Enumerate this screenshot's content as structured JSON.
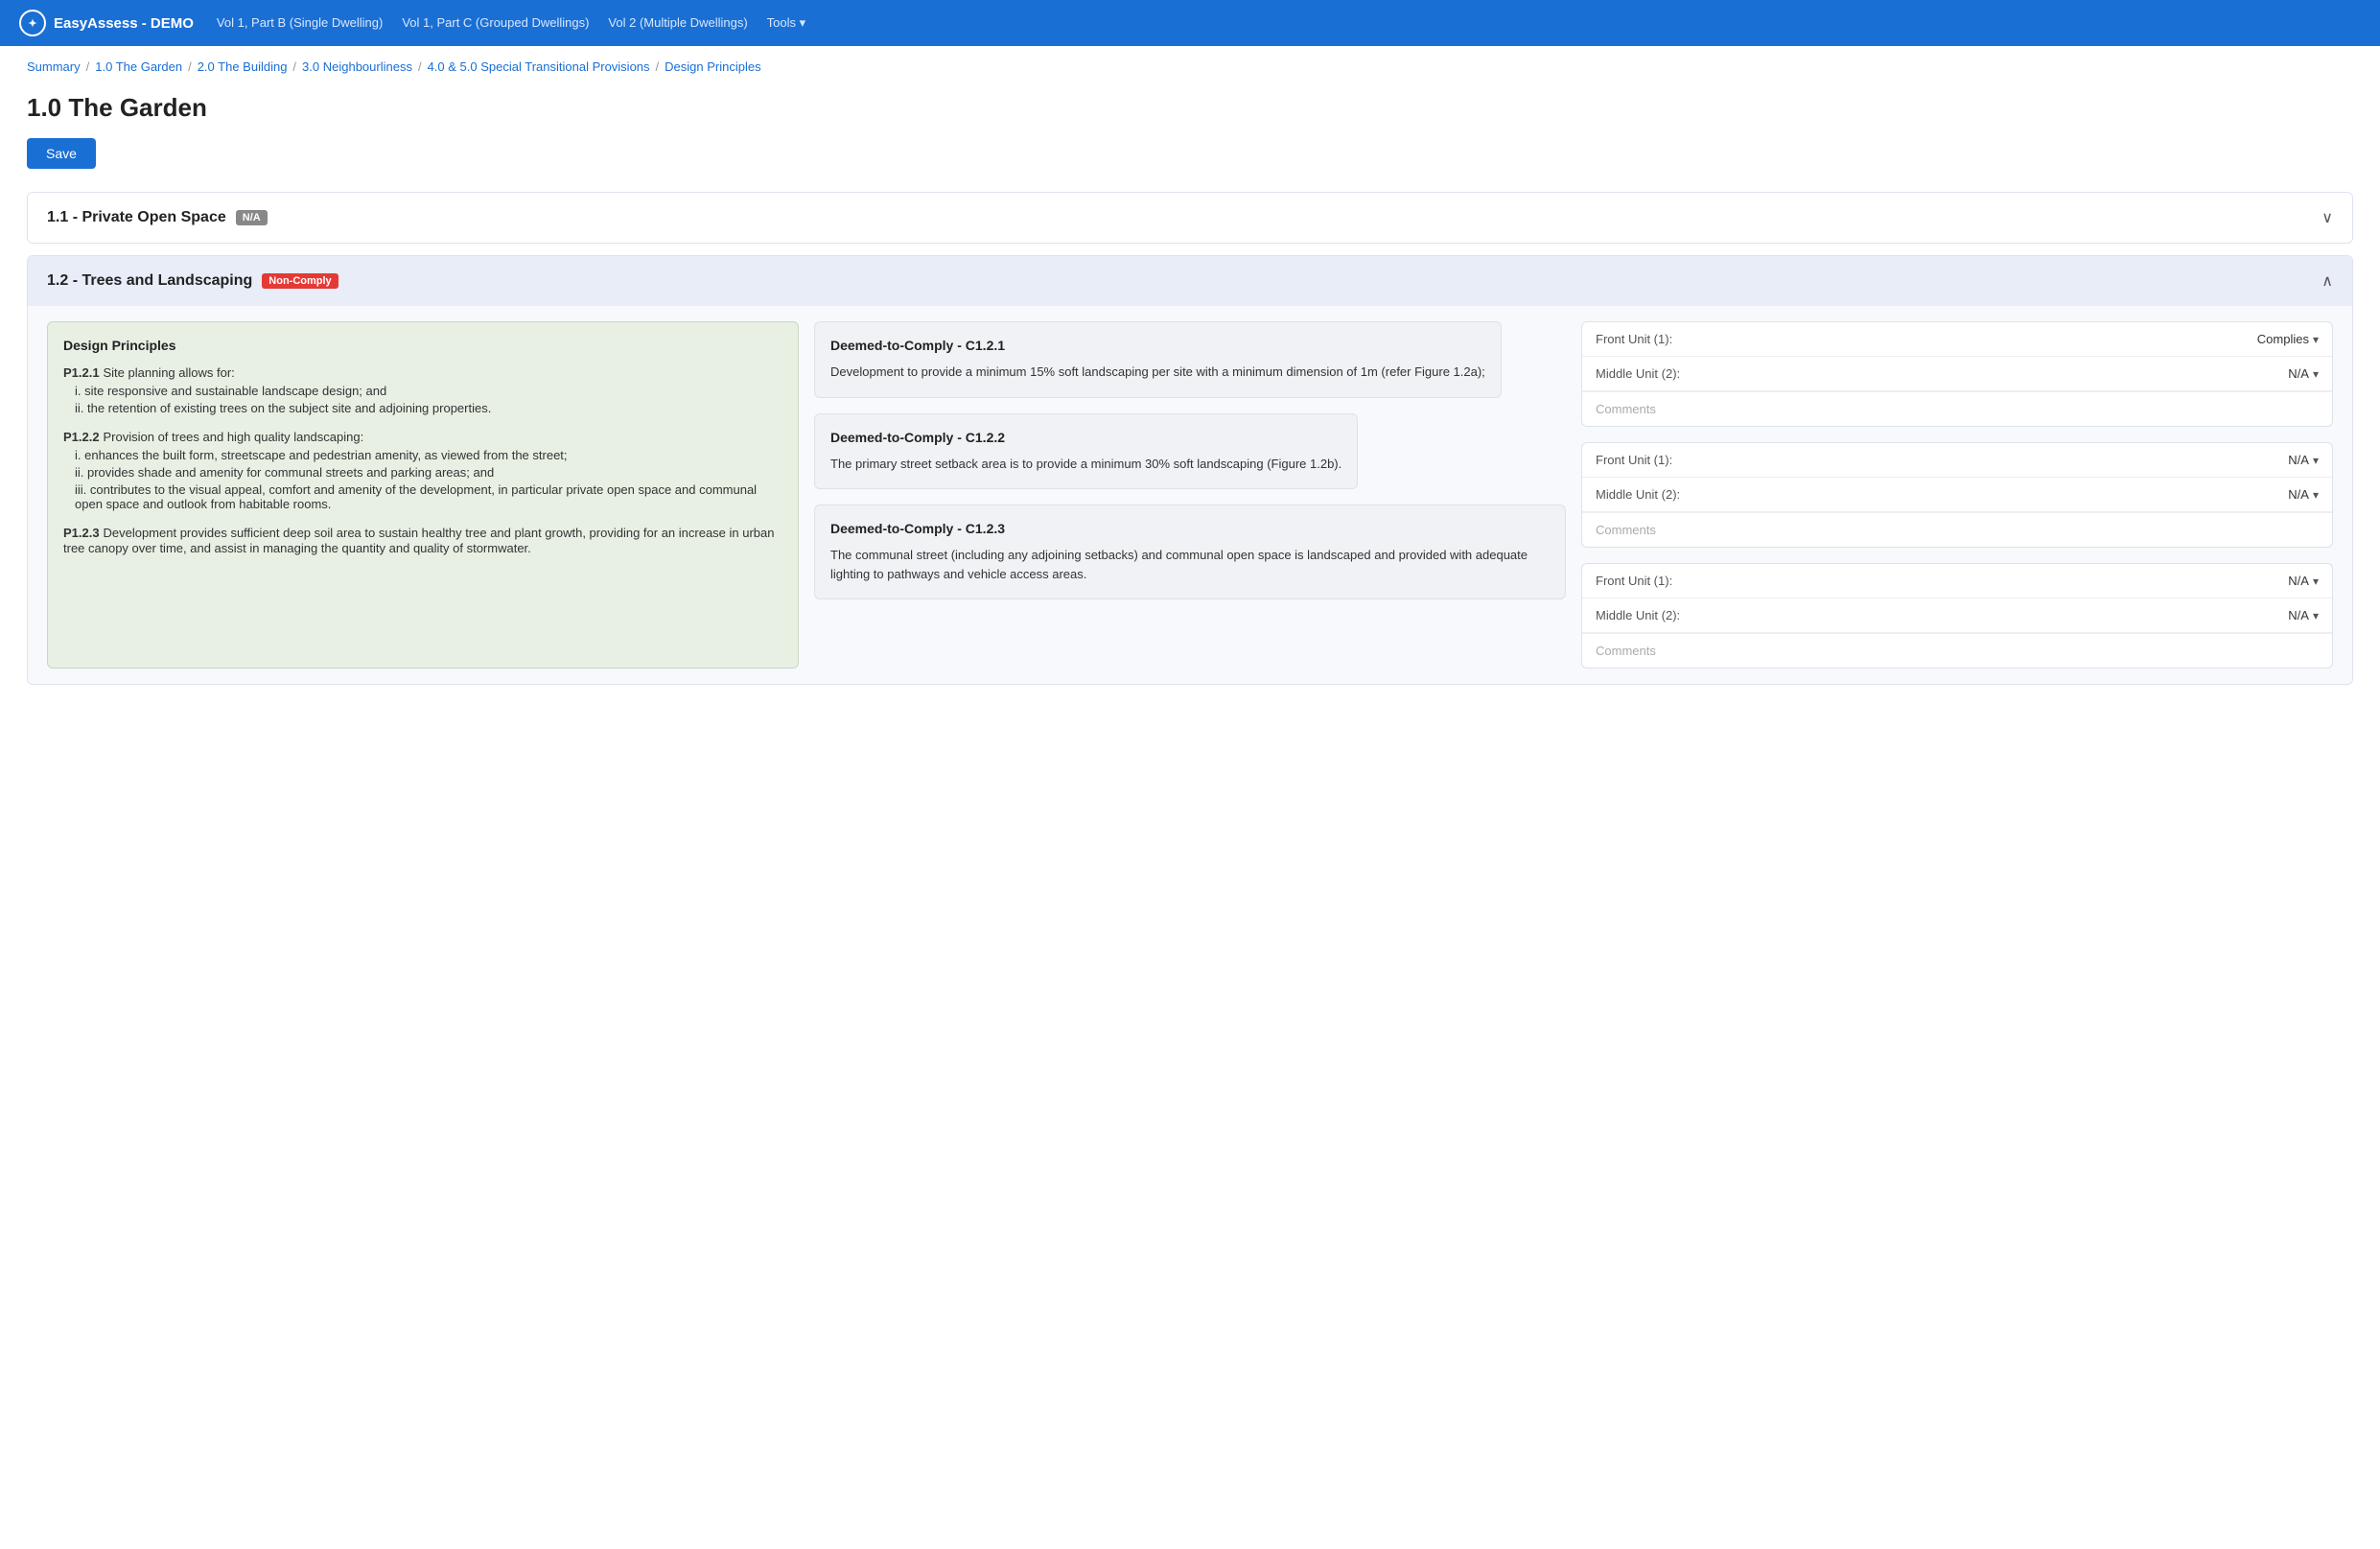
{
  "nav": {
    "brand": "EasyAssess - DEMO",
    "brand_icon": "EA",
    "links": [
      {
        "label": "Vol 1, Part B (Single Dwelling)"
      },
      {
        "label": "Vol 1, Part C (Grouped Dwellings)"
      },
      {
        "label": "Vol 2 (Multiple Dwellings)"
      },
      {
        "label": "Tools ▾"
      }
    ]
  },
  "breadcrumb": {
    "items": [
      {
        "label": "Summary"
      },
      {
        "label": "1.0 The Garden"
      },
      {
        "label": "2.0 The Building"
      },
      {
        "label": "3.0 Neighbourliness"
      },
      {
        "label": "4.0 & 5.0 Special Transitional Provisions"
      },
      {
        "label": "Design Principles"
      }
    ]
  },
  "page": {
    "title": "1.0 The Garden",
    "save_button": "Save"
  },
  "sections": [
    {
      "id": "s1",
      "title": "1.1 - Private Open Space",
      "badge_text": "N/A",
      "badge_type": "na",
      "expanded": false
    },
    {
      "id": "s2",
      "title": "1.2 - Trees and Landscaping",
      "badge_text": "Non-Comply",
      "badge_type": "noncomply",
      "expanded": true,
      "design_principles": {
        "title": "Design Principles",
        "items": [
          {
            "label": "P1.2.1",
            "text": " Site planning allows for:",
            "list": [
              "i.  site responsive and sustainable landscape design; and",
              "ii. the retention of existing trees on the subject site and adjoining properties."
            ]
          },
          {
            "label": "P1.2.2",
            "text": " Provision of trees and high quality landscaping:",
            "list": [
              "i.  enhances the built form, streetscape and pedestrian amenity, as viewed from the street;",
              "ii. provides shade and amenity for communal streets and parking areas; and",
              "iii. contributes to the visual appeal, comfort and amenity of the development, in particular private open space and communal open space and outlook from habitable rooms."
            ]
          },
          {
            "label": "P1.2.3",
            "text": " Development provides sufficient deep soil area to sustain healthy tree and plant growth, providing for an increase in urban tree canopy over time, and assist in managing the quantity and quality of stormwater.",
            "list": []
          }
        ]
      },
      "dtc_cards": [
        {
          "id": "c1",
          "title": "Deemed-to-Comply - C1.2.1",
          "text": "Development to provide a minimum 15% soft landscaping per site with a minimum dimension of 1m (refer Figure 1.2a);",
          "compliance": [
            {
              "label": "Front Unit (1):",
              "value": "Complies"
            },
            {
              "label": "Middle Unit (2):",
              "value": "N/A"
            }
          ],
          "comments_placeholder": "Comments"
        },
        {
          "id": "c2",
          "title": "Deemed-to-Comply - C1.2.2",
          "text": "The primary street setback area is to provide a minimum 30% soft landscaping (Figure 1.2b).",
          "compliance": [
            {
              "label": "Front Unit (1):",
              "value": "N/A"
            },
            {
              "label": "Middle Unit (2):",
              "value": "N/A"
            }
          ],
          "comments_placeholder": "Comments"
        },
        {
          "id": "c3",
          "title": "Deemed-to-Comply - C1.2.3",
          "text": "The communal street (including any adjoining setbacks) and communal open space is landscaped and provided with adequate lighting to pathways and vehicle access areas.",
          "compliance": [
            {
              "label": "Front Unit (1):",
              "value": "N/A"
            },
            {
              "label": "Middle Unit (2):",
              "value": "N/A"
            }
          ],
          "comments_placeholder": "Comments"
        }
      ]
    }
  ]
}
